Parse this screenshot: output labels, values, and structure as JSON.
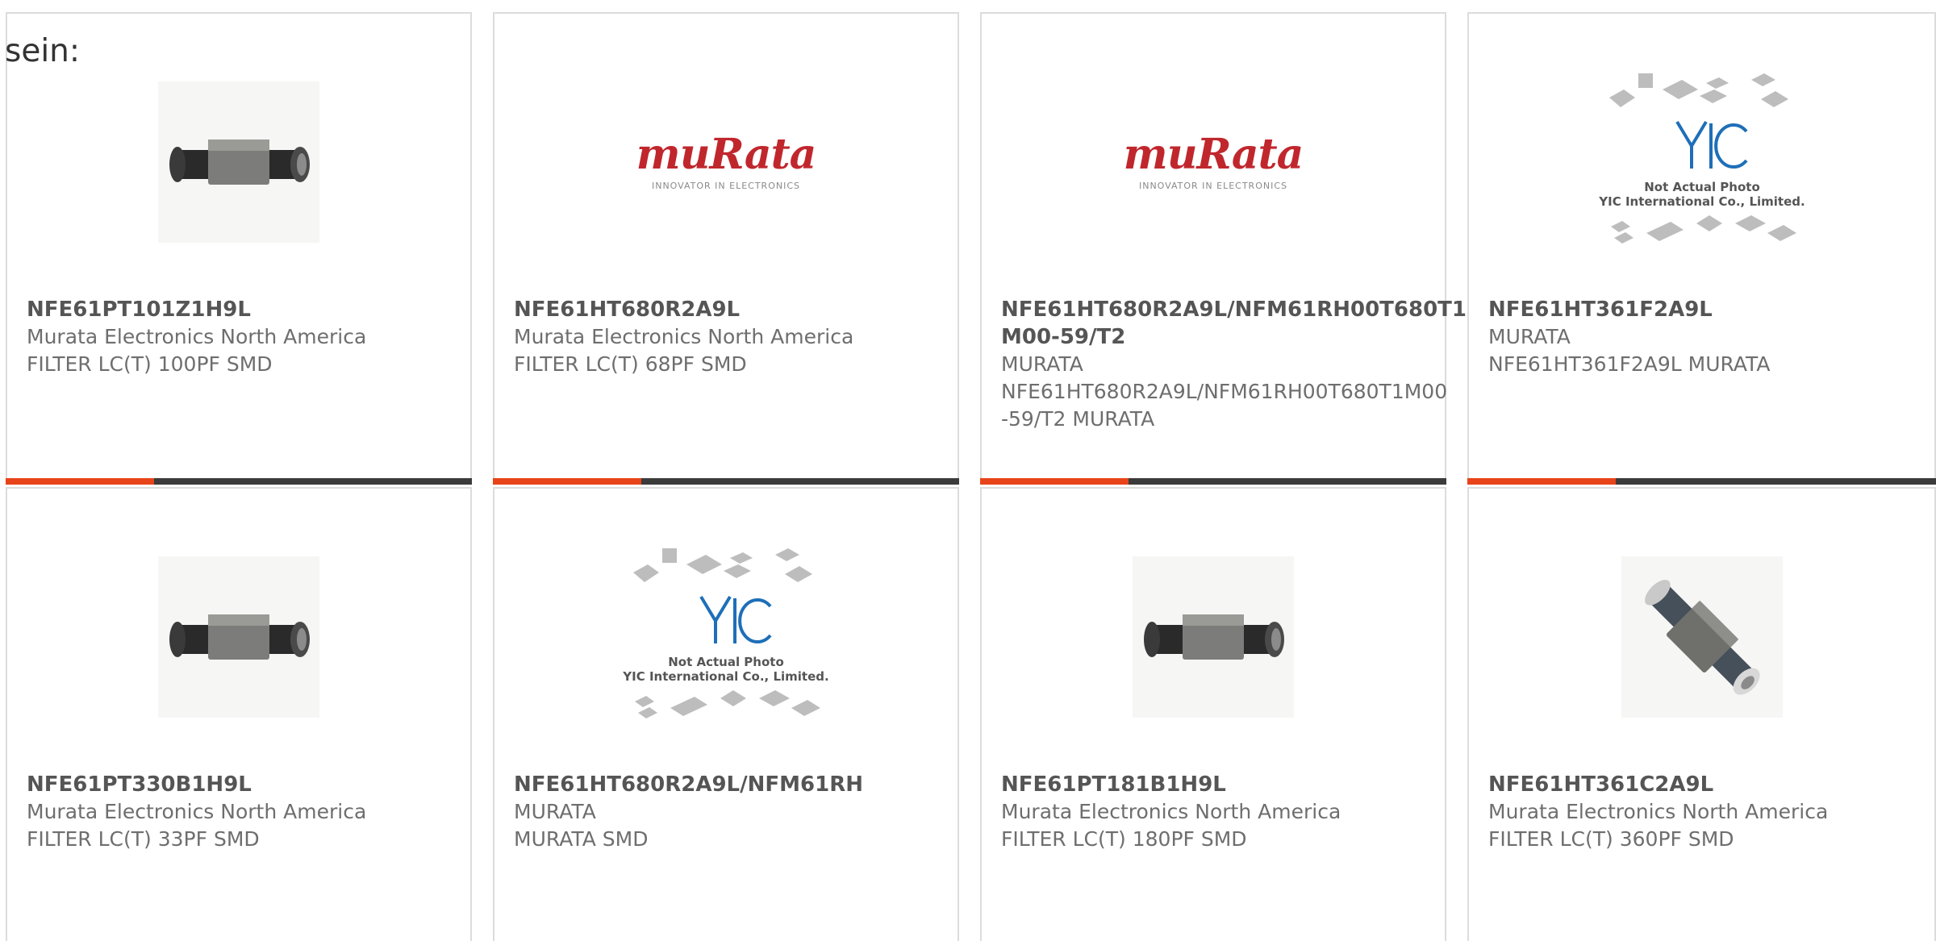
{
  "page": {
    "lead_text": "sein:"
  },
  "colors": {
    "accent": "#e8441a",
    "bar": "#3b3b3b",
    "logo_red": "#c0272d",
    "card_border": "#dcdcdc"
  },
  "brand_logo": {
    "wordmark": "muRata",
    "tagline": "INNOVATOR IN ELECTRONICS"
  },
  "placeholder_image": {
    "logo": "YIC",
    "line1": "Not Actual Photo",
    "line2": "YIC International Co., Limited."
  },
  "products": [
    {
      "part_number": "NFE61PT101Z1H9L",
      "manufacturer": "Murata Electronics North America",
      "description": "FILTER LC(T) 100PF SMD",
      "image": "component-photo"
    },
    {
      "part_number": "NFE61HT680R2A9L",
      "manufacturer": "Murata Electronics North America",
      "description": "FILTER LC(T) 68PF SMD",
      "image": "murata-logo"
    },
    {
      "part_number": "NFE61HT680R2A9L/NFM61RH00T680T1M00-59/T2",
      "manufacturer": "MURATA",
      "description": "NFE61HT680R2A9L/NFM61RH00T680T1M00-59/T2 MURATA",
      "image": "murata-logo"
    },
    {
      "part_number": "NFE61HT361F2A9L",
      "manufacturer": "MURATA",
      "description": "NFE61HT361F2A9L MURATA",
      "image": "yic-placeholder"
    },
    {
      "part_number": "NFE61PT330B1H9L",
      "manufacturer": "Murata Electronics North America",
      "description": "FILTER LC(T) 33PF SMD",
      "image": "component-photo"
    },
    {
      "part_number": "NFE61HT680R2A9L/NFM61RH",
      "manufacturer": "MURATA",
      "description": "MURATA SMD",
      "image": "yic-placeholder"
    },
    {
      "part_number": "NFE61PT181B1H9L",
      "manufacturer": "Murata Electronics North America",
      "description": "FILTER LC(T) 180PF SMD",
      "image": "component-photo"
    },
    {
      "part_number": "NFE61HT361C2A9L",
      "manufacturer": "Murata Electronics North America",
      "description": "FILTER LC(T) 360PF SMD",
      "image": "component-photo-angled"
    }
  ]
}
